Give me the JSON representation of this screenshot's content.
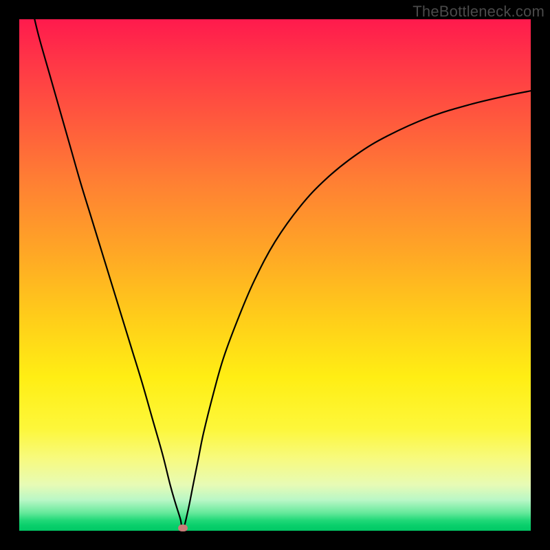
{
  "watermark": "TheBottleneck.com",
  "chart_data": {
    "type": "line",
    "title": "",
    "xlabel": "",
    "ylabel": "",
    "xlim": [
      0,
      100
    ],
    "ylim": [
      0,
      100
    ],
    "x": [
      3,
      4,
      6,
      8,
      10,
      12,
      14,
      16,
      18,
      20,
      22,
      24,
      26,
      28,
      29.5,
      30.5,
      31.5,
      32,
      33,
      34,
      35,
      36,
      38,
      40,
      43,
      46,
      50,
      55,
      60,
      66,
      72,
      80,
      88,
      96,
      100
    ],
    "values": [
      100,
      96,
      89,
      82,
      75,
      68,
      61.5,
      55,
      48.5,
      42,
      35.5,
      29,
      22,
      15,
      9,
      5.5,
      2.3,
      0.2,
      4,
      9,
      14,
      19,
      27,
      34,
      42,
      49,
      56.5,
      63.5,
      68.8,
      73.6,
      77.2,
      80.8,
      83.3,
      85.2,
      86
    ],
    "grid": false,
    "legend": false,
    "marker": {
      "x": 32,
      "y": 0.6
    }
  }
}
